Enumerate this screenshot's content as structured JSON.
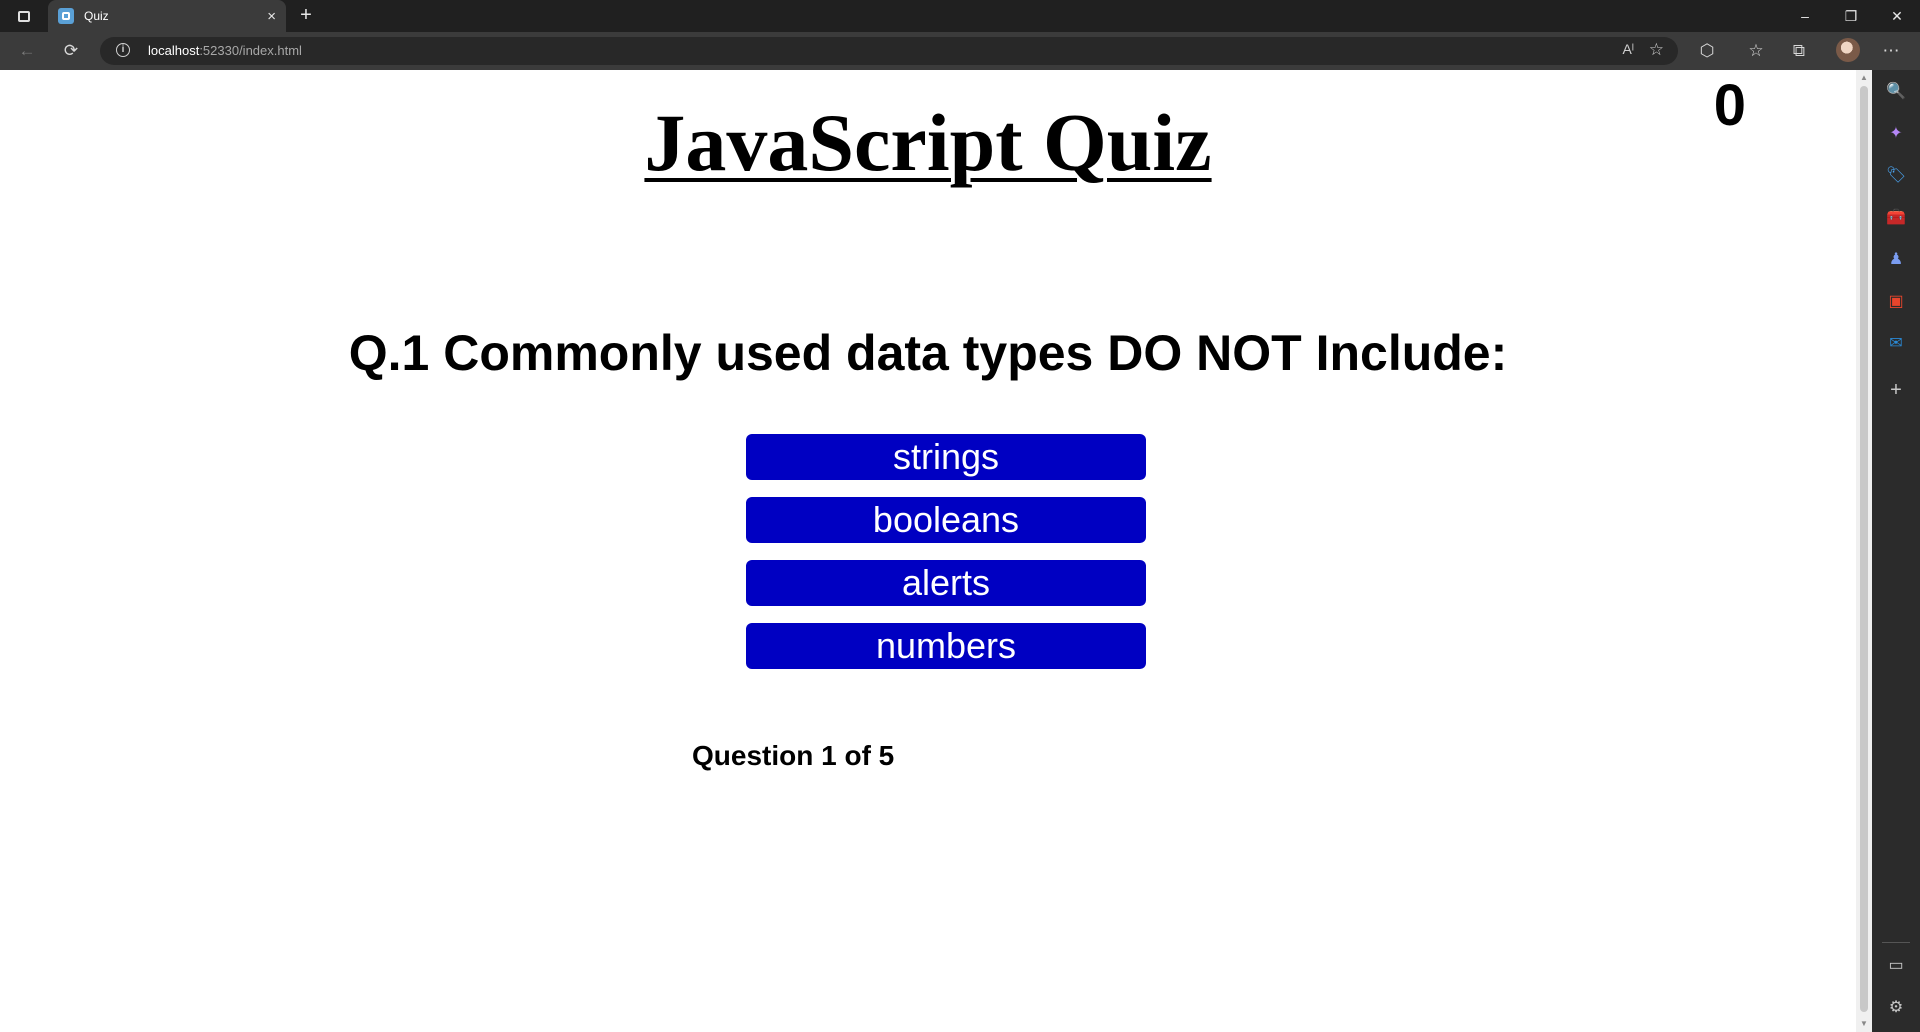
{
  "browser": {
    "tab_title": "Quiz",
    "tab_close_icon": "×",
    "new_tab_icon": "+",
    "url_host": "localhost",
    "url_path": ":52330/index.html",
    "read_aloud_icon": "Aˡ",
    "favorite_icon": "☆",
    "window_controls": {
      "minimize": "–",
      "restore": "❐",
      "close": "✕"
    },
    "toolbar_icons": {
      "back": "←",
      "refresh": "⟳",
      "extensions": "⬡",
      "favorites": "☆",
      "collections": "⧉",
      "more": "⋯"
    }
  },
  "quiz": {
    "score": "0",
    "heading": "JavaScript Quiz",
    "question": "Q.1 Commonly used data types DO NOT Include:",
    "answers": [
      "strings",
      "booleans",
      "alerts",
      "numbers"
    ],
    "progress": "Question 1 of 5"
  },
  "sidebar": {
    "icons": [
      "search-icon",
      "copilot-icon",
      "shopping-tag-icon",
      "tools-icon",
      "games-icon",
      "office-icon",
      "outlook-icon",
      "add-icon",
      "layout-icon",
      "settings-icon"
    ],
    "glyphs": {
      "search": "🔍",
      "copilot": "✦",
      "tag": "🏷",
      "tools": "🧰",
      "games": "♟",
      "office": "▣",
      "outlook": "✉",
      "add": "+",
      "layout": "▭",
      "settings": "⚙"
    }
  },
  "colors": {
    "answer_bg": "#0000c2",
    "chrome_dark": "#202020",
    "toolbar": "#3b3b3b"
  }
}
